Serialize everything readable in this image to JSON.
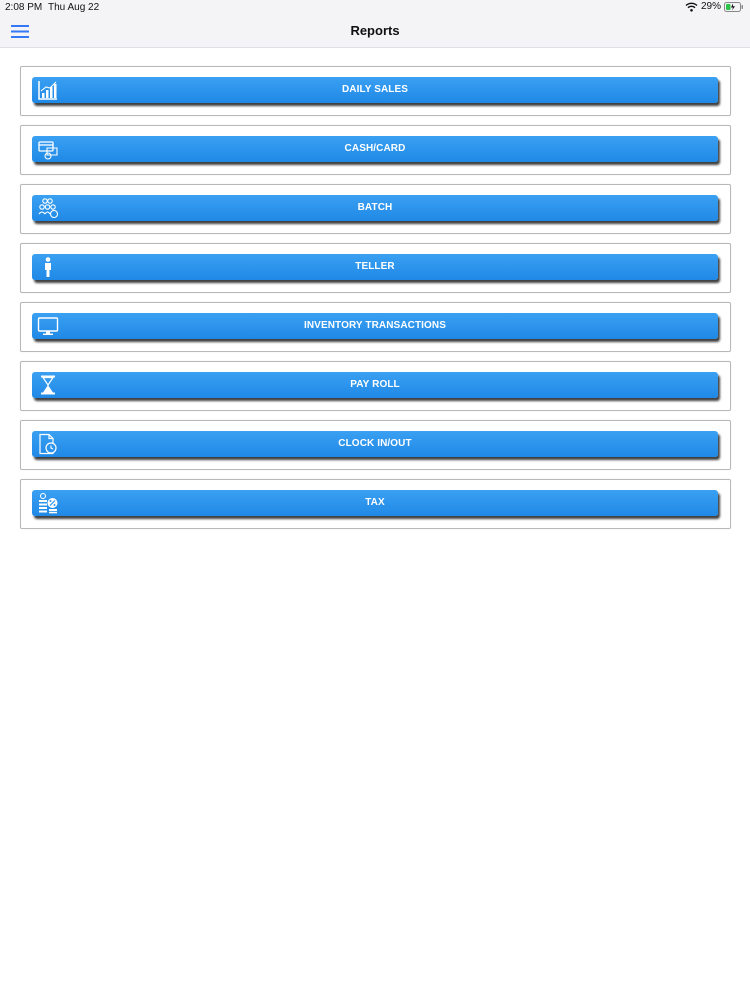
{
  "status_bar": {
    "time": "2:08 PM",
    "date": "Thu Aug 22",
    "battery_percent": "29%",
    "wifi_icon": "wifi-icon",
    "battery_icon": "battery-charging-icon"
  },
  "nav": {
    "title": "Reports",
    "menu_icon": "hamburger-menu-icon"
  },
  "colors": {
    "button_blue": "#2a93ec",
    "nav_background": "#f4f4f6"
  },
  "reports": [
    {
      "label": "DAILY SALES",
      "icon": "bar-chart-icon"
    },
    {
      "label": "CASH/CARD",
      "icon": "cash-card-icon"
    },
    {
      "label": "BATCH",
      "icon": "batch-group-icon"
    },
    {
      "label": "TELLER",
      "icon": "person-icon"
    },
    {
      "label": "INVENTORY TRANSACTIONS",
      "icon": "monitor-icon"
    },
    {
      "label": "PAY ROLL",
      "icon": "hourglass-icon"
    },
    {
      "label": "CLOCK IN/OUT",
      "icon": "document-clock-icon"
    },
    {
      "label": "TAX",
      "icon": "coins-tax-icon"
    }
  ]
}
